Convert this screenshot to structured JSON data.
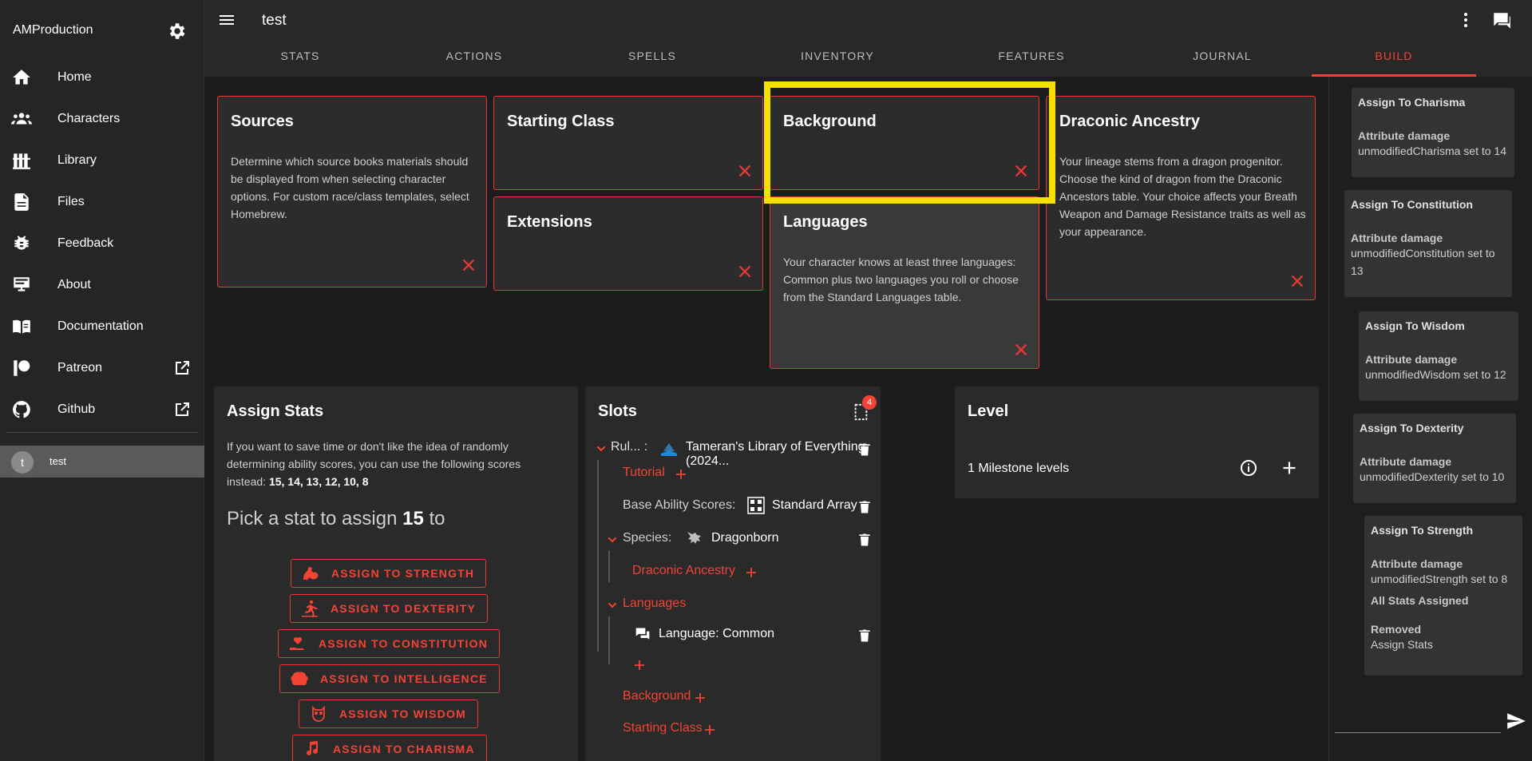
{
  "sidebar": {
    "brand": "AMProduction",
    "items": [
      {
        "label": "Home",
        "icon": "home-icon"
      },
      {
        "label": "Characters",
        "icon": "people-icon"
      },
      {
        "label": "Library",
        "icon": "library-icon"
      },
      {
        "label": "Files",
        "icon": "file-icon"
      },
      {
        "label": "Feedback",
        "icon": "bug-icon"
      },
      {
        "label": "About",
        "icon": "about-icon"
      },
      {
        "label": "Documentation",
        "icon": "book-icon"
      },
      {
        "label": "Patreon",
        "icon": "patreon-icon"
      },
      {
        "label": "Github",
        "icon": "github-icon"
      }
    ],
    "user": {
      "initial": "t",
      "name": "test"
    }
  },
  "appbar": {
    "title": "test",
    "tabs": [
      "STATS",
      "ACTIONS",
      "SPELLS",
      "INVENTORY",
      "FEATURES",
      "JOURNAL",
      "BUILD"
    ],
    "active_tab": "BUILD"
  },
  "cards": {
    "sources": {
      "title": "Sources",
      "desc": "Determine which source books materials should be displayed from when selecting character options. For custom race/class templates, select Homebrew."
    },
    "starting_class": {
      "title": "Starting Class"
    },
    "extensions": {
      "title": "Extensions"
    },
    "background": {
      "title": "Background"
    },
    "languages": {
      "title": "Languages",
      "desc": "Your character knows at least three languages: Common plus two languages you roll or choose from the Standard Languages table."
    },
    "draconic": {
      "title": "Draconic Ancestry",
      "desc": "Your lineage stems from a dragon progenitor. Choose the kind of dragon from the Draconic Ancestors table. Your choice affects your Breath Weapon and Damage Resistance traits as well as your appearance."
    }
  },
  "assign_stats": {
    "title": "Assign Stats",
    "desc_prefix": "If you want to save time or don't like the idea of randomly determining ability scores, you can use the following scores instead: ",
    "scores": "15, 14, 13, 12, 10, 8",
    "pick_prefix": "Pick a stat to assign ",
    "pick_value": "15",
    "pick_suffix": " to",
    "buttons": [
      "ASSIGN TO STRENGTH",
      "ASSIGN TO DEXTERITY",
      "ASSIGN TO CONSTITUTION",
      "ASSIGN TO INTELLIGENCE",
      "ASSIGN TO WISDOM",
      "ASSIGN TO CHARISMA"
    ]
  },
  "slots": {
    "title": "Slots",
    "badge": "4",
    "rules_label": "Rul... :",
    "rules_value": "Tameran's Library of Everything (2024...",
    "tutorial": "Tutorial",
    "base_label": "Base Ability Scores:",
    "base_value": "Standard Array",
    "species_label": "Species:",
    "species_value": "Dragonborn",
    "draconic": "Draconic Ancestry",
    "languages": "Languages",
    "language_item": "Language: Common",
    "background": "Background",
    "starting_class": "Starting Class"
  },
  "level": {
    "title": "Level",
    "milestone": "1 Milestone levels"
  },
  "log": [
    {
      "title": "Assign To Charisma",
      "key": "Attribute damage",
      "value": "unmodifiedCharisma set to 14"
    },
    {
      "title": "Assign To Constitution",
      "key": "Attribute damage",
      "value": "unmodifiedConstitution set to 13"
    },
    {
      "title": "Assign To Wisdom",
      "key": "Attribute damage",
      "value": "unmodifiedWisdom set to 12"
    },
    {
      "title": "Assign To Dexterity",
      "key": "Attribute damage",
      "value": "unmodifiedDexterity set to 10"
    },
    {
      "title": "Assign To Strength",
      "key": "Attribute damage",
      "value": "unmodifiedStrength set to 8",
      "key2": "All Stats Assigned",
      "key3": "Removed",
      "value3": "Assign Stats"
    }
  ],
  "colors": {
    "accent": "#f44336",
    "highlight": "#f5e000"
  }
}
